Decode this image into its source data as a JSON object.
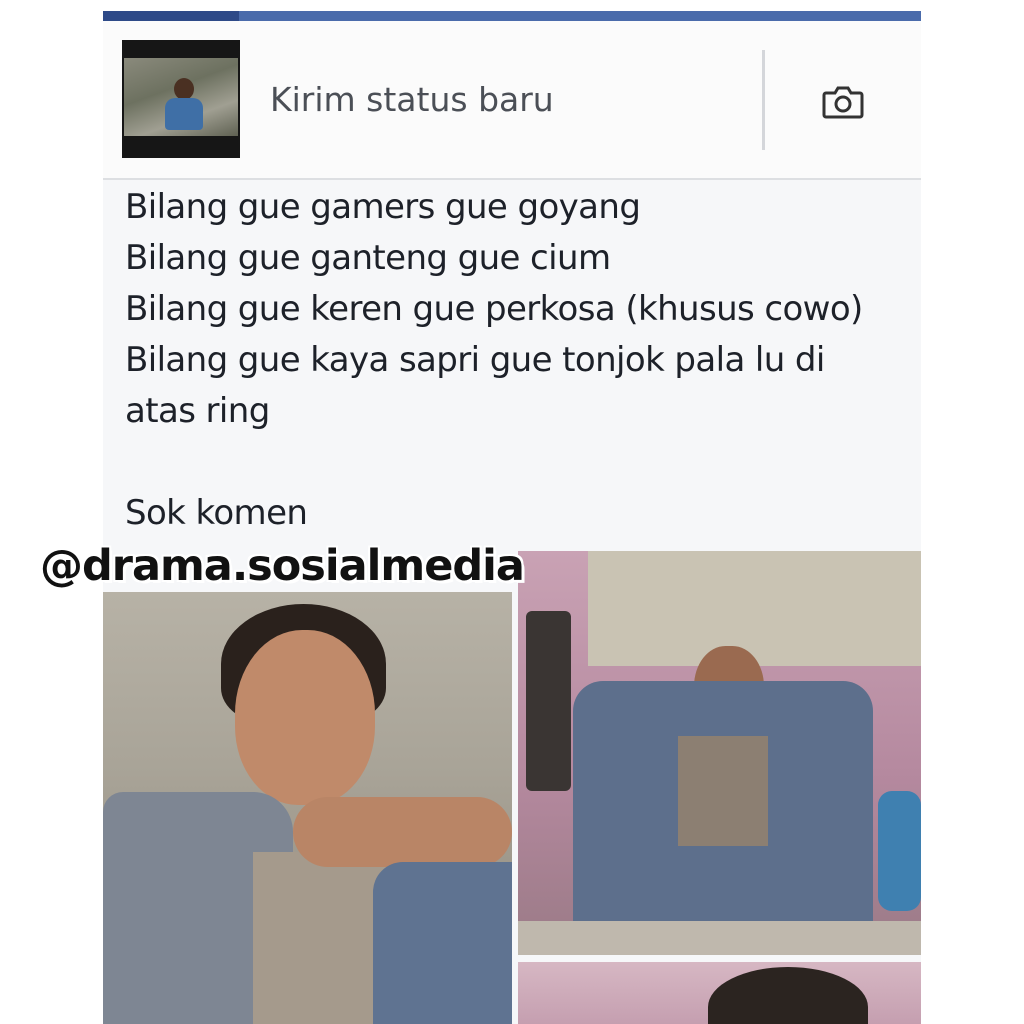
{
  "composer": {
    "placeholder": "Kirim status baru",
    "avatar_icon": "profile-photo",
    "camera_icon": "camera-icon"
  },
  "post": {
    "lines": [
      "Bilang gue gamers gue goyang",
      "Bilang gue ganteng gue cium",
      "Bilang gue keren gue perkosa (khusus cowo)",
      "Bilang gue kaya sapri gue tonjok pala lu di",
      "atas ring",
      "",
      "Sok komen"
    ]
  },
  "watermark": "@drama.sosialmedia",
  "colors": {
    "header_blue": "#4a6bab",
    "text": "#1d2129",
    "placeholder": "#4b4f56"
  }
}
